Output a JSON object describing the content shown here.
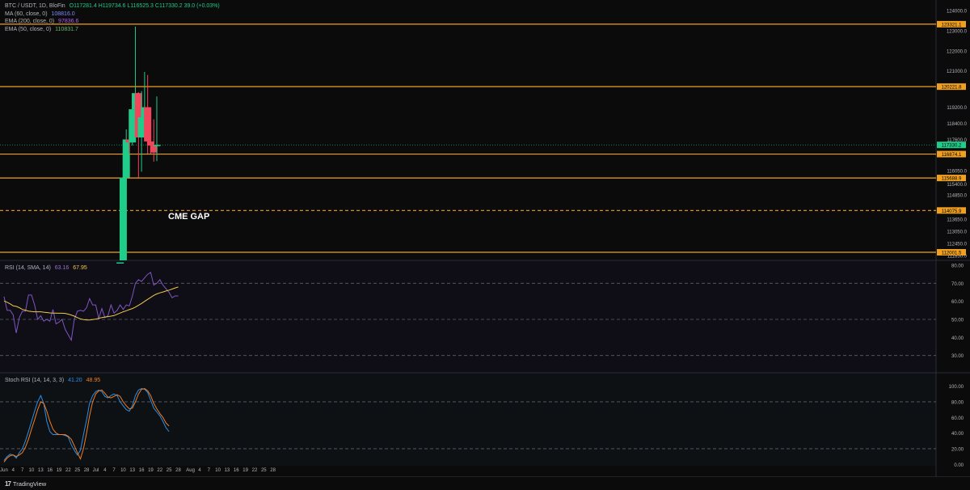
{
  "legend": {
    "title": "BTC / USDT, 1D, BloFin",
    "ohlc": "O117281.4 H119734.6 L116525.3 C117330.2 39.0 (+0.03%)",
    "ma60": {
      "label": "MA (60, close, 0)",
      "value": "108816.0",
      "color": "#7e8cff"
    },
    "ema200": {
      "label": "EMA (200, close, 0)",
      "value": "97836.6",
      "color": "#b05cff"
    },
    "ema50": {
      "label": "EMA (50, close, 0)",
      "value": "110831.7",
      "color": "#66bb6a"
    }
  },
  "footer": {
    "brand": "TradingView"
  },
  "colors": {
    "up": "#1fcc8a",
    "down": "#f0455a",
    "level": "#f0a020",
    "rsi": "#7e57c2",
    "rsi_ma": "#f2c94c",
    "stoch_k": "#2a8ee8",
    "stoch_d": "#f57c1f"
  },
  "chart_data": [
    {
      "type": "candlestick",
      "pane": "price",
      "title": "BTC / USDT, 1D, BloFin",
      "ylim": [
        111600,
        124200
      ],
      "y_ticks": [
        "124000.0",
        "123000.0",
        "122000.0",
        "121000.0",
        "119200.0",
        "118400.0",
        "117600.0",
        "116050.0",
        "115400.0",
        "114850.0",
        "113650.0",
        "113050.0",
        "112450.0",
        "111850.0"
      ],
      "x_ticks": [
        "Jun",
        "4",
        "7",
        "10",
        "13",
        "16",
        "19",
        "22",
        "25",
        "28",
        "Jul",
        "4",
        "7",
        "10",
        "13",
        "16",
        "19",
        "22",
        "25",
        "28",
        "Aug",
        "4",
        "7",
        "10",
        "13",
        "16",
        "19",
        "22",
        "25",
        "28"
      ],
      "candles": [
        {
          "date": "2025-07-09",
          "o": 108900,
          "h": 111900,
          "l": 108500,
          "c": 111500
        },
        {
          "date": "2025-07-10",
          "o": 111500,
          "h": 116900,
          "l": 110700,
          "c": 115700
        },
        {
          "date": "2025-07-11",
          "o": 115700,
          "h": 118100,
          "l": 115300,
          "c": 117600
        },
        {
          "date": "2025-07-12",
          "o": 117600,
          "h": 118200,
          "l": 116900,
          "c": 117450
        },
        {
          "date": "2025-07-13",
          "o": 117450,
          "h": 119500,
          "l": 117300,
          "c": 119100
        },
        {
          "date": "2025-07-14",
          "o": 119100,
          "h": 123200,
          "l": 118900,
          "c": 119900
        },
        {
          "date": "2025-07-15",
          "o": 119900,
          "h": 119950,
          "l": 115700,
          "c": 117700
        },
        {
          "date": "2025-07-16",
          "o": 117700,
          "h": 120000,
          "l": 116000,
          "c": 118700
        },
        {
          "date": "2025-07-17",
          "o": 118700,
          "h": 120950,
          "l": 117600,
          "c": 119200
        },
        {
          "date": "2025-07-18",
          "o": 119200,
          "h": 120800,
          "l": 116900,
          "c": 117500
        },
        {
          "date": "2025-07-19",
          "o": 117500,
          "h": 118000,
          "l": 116900,
          "c": 117300
        },
        {
          "date": "2025-07-20",
          "o": 117300,
          "h": 118600,
          "l": 116500,
          "c": 116950
        },
        {
          "date": "2025-07-21",
          "o": 117281.4,
          "h": 119734.6,
          "l": 116525.3,
          "c": 117330.2
        }
      ],
      "levels": [
        {
          "value": 123321.1,
          "label": "123321.1",
          "style": "solid"
        },
        {
          "value": 120221.8,
          "label": "120221.8",
          "style": "solid"
        },
        {
          "value": 116874.1,
          "label": "116874.1",
          "style": "solid"
        },
        {
          "value": 115688.9,
          "label": "115688.9",
          "style": "solid"
        },
        {
          "value": 114075.9,
          "label": "114075.9",
          "style": "dashed"
        },
        {
          "value": 112001.5,
          "label": "112001.5",
          "style": "solid"
        }
      ],
      "price_tag": {
        "value": 117330.2,
        "label": "117330.2"
      },
      "annotations": [
        {
          "text": "CME GAP",
          "x": "2025-07-21",
          "y": 113650
        }
      ]
    },
    {
      "type": "line",
      "pane": "rsi",
      "title": "RSI (14, SMA, 14)",
      "ylim": [
        20,
        80
      ],
      "y_ticks": [
        "80.00",
        "70.00",
        "60.00",
        "50.00",
        "40.00",
        "30.00"
      ],
      "bands": [
        70,
        50,
        30
      ],
      "series": [
        {
          "name": "RSI",
          "value_label": "63.16",
          "color": "#7e57c2",
          "values": [
            62.6,
            55,
            55,
            52.5,
            42.5,
            51,
            54.5,
            54.5,
            63.5,
            63.5,
            58,
            50,
            52,
            49,
            50,
            49,
            55.5,
            47.5,
            48.5,
            50,
            44.5,
            41.5,
            38.5,
            50,
            54.5,
            55,
            54.5,
            56.5,
            61.5,
            58,
            58,
            50.5,
            56,
            51,
            52,
            58,
            53.5,
            55,
            58,
            55.5,
            58,
            57.5,
            63,
            70,
            72,
            71,
            73,
            75,
            76,
            69,
            70,
            72,
            69,
            67,
            65,
            62,
            63,
            63
          ]
        },
        {
          "name": "RSI-based MA",
          "value_label": "67.95",
          "color": "#f2c94c",
          "values": [
            60.2,
            59.5,
            58.6,
            57.5,
            57.2,
            56.5,
            55.5,
            55.1,
            54.6,
            54.4,
            54.2,
            54.2,
            54.2,
            54,
            53.8,
            53.6,
            53.5,
            53.5,
            53.4,
            53.4,
            53.3,
            52.9,
            52.4,
            51.8,
            51,
            50.3,
            49.9,
            49.7,
            49.7,
            49.9,
            50.2,
            50.6,
            51,
            51.3,
            51.5,
            51.8,
            52.1,
            52.8,
            53.5,
            54.2,
            54.8,
            55.4,
            56,
            56.8,
            57.8,
            58.8,
            60,
            61.1,
            62.2,
            63.3,
            64.1,
            64.7,
            65.2,
            65.7,
            66.2,
            66.8,
            67.4,
            67.95
          ]
        }
      ]
    },
    {
      "type": "line",
      "pane": "stoch_rsi",
      "title": "Stoch RSI (14, 14, 3, 3)",
      "ylim": [
        -8,
        112
      ],
      "y_ticks": [
        "100.00",
        "80.00",
        "60.00",
        "40.00",
        "20.00",
        "0.00"
      ],
      "bands": [
        80,
        20
      ],
      "series": [
        {
          "name": "K",
          "value_label": "41.20",
          "color": "#2a8ee8",
          "values": [
            5,
            10,
            13,
            12,
            8,
            15,
            20,
            30,
            42,
            55,
            68,
            80,
            88,
            78,
            55,
            42,
            38,
            38,
            38,
            38,
            37,
            35,
            25,
            18,
            12,
            18,
            38,
            57,
            78,
            88,
            93,
            95,
            93,
            87,
            85,
            88,
            90,
            88,
            80,
            75,
            70,
            68,
            75,
            88,
            95,
            97,
            96,
            92,
            82,
            72,
            67,
            62,
            55,
            47,
            42
          ]
        },
        {
          "name": "D",
          "value_label": "48.95",
          "color": "#f57c1f",
          "values": [
            3,
            8,
            11,
            12,
            10,
            12,
            15,
            22,
            32,
            45,
            57,
            70,
            80,
            78,
            68,
            55,
            45,
            40,
            38,
            38,
            38,
            36,
            32,
            24,
            15,
            7,
            20,
            40,
            62,
            80,
            90,
            94,
            95,
            91,
            86,
            85,
            87,
            89,
            87,
            80,
            75,
            71,
            72,
            80,
            90,
            96,
            97,
            94,
            88,
            78,
            71,
            65,
            60,
            53,
            49
          ]
        }
      ]
    }
  ]
}
